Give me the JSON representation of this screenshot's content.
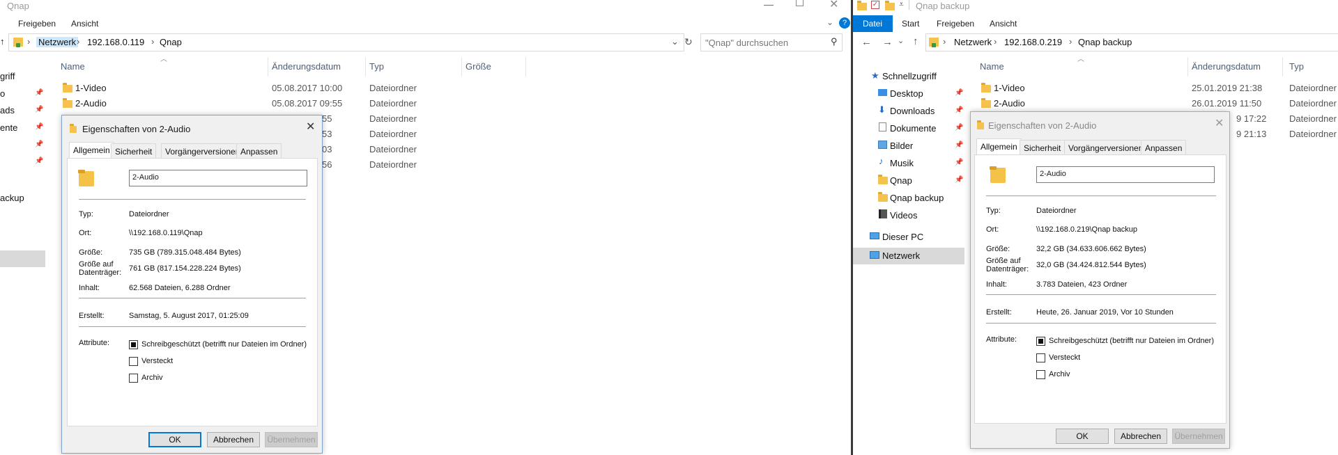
{
  "left_window": {
    "title": "Qnap",
    "ribbon_tabs": [
      "Freigeben",
      "Ansicht"
    ],
    "breadcrumb": [
      "Netzwerk",
      "192.168.0.119",
      "Qnap"
    ],
    "search_placeholder": "\"Qnap\" durchsuchen",
    "columns": {
      "name": "Name",
      "date": "Änderungsdatum",
      "type": "Typ",
      "size": "Größe"
    },
    "rows": [
      {
        "name": "1-Video",
        "date": "05.08.2017 10:00",
        "type": "Dateiordner"
      },
      {
        "name": "2-Audio",
        "date": "05.08.2017 09:55",
        "type": "Dateiordner"
      },
      {
        "name": "",
        "date": "55",
        "type": "Dateiordner"
      },
      {
        "name": "",
        "date": "53",
        "type": "Dateiordner"
      },
      {
        "name": "",
        "date": "03",
        "type": "Dateiordner"
      },
      {
        "name": "",
        "date": "56",
        "type": "Dateiordner"
      }
    ],
    "nav_items": [
      "griff",
      "o",
      "ads",
      "ente",
      "",
      "",
      "ackup"
    ],
    "dialog": {
      "title": "Eigenschaften von 2-Audio",
      "tabs": [
        "Allgemein",
        "Sicherheit",
        "Vorgängerversionen",
        "Anpassen"
      ],
      "name_value": "2-Audio",
      "type_label": "Typ:",
      "type_value": "Dateiordner",
      "location_label": "Ort:",
      "location_value": "\\\\192.168.0.119\\Qnap",
      "size_label": "Größe:",
      "size_value": "735 GB (789.315.048.484 Bytes)",
      "disk_label_1": "Größe auf",
      "disk_label_2": "Datenträger:",
      "disk_value": "761 GB (817.154.228.224 Bytes)",
      "contents_label": "Inhalt:",
      "contents_value": "62.568 Dateien, 6.288 Ordner",
      "created_label": "Erstellt:",
      "created_value": "Samstag, 5. August 2017, 01:25:09",
      "attributes_label": "Attribute:",
      "attr_readonly": "Schreibgeschützt (betrifft nur Dateien im Ordner)",
      "attr_hidden": "Versteckt",
      "attr_archive": "Archiv",
      "ok": "OK",
      "cancel": "Abbrechen",
      "apply": "Übernehmen"
    }
  },
  "right_window": {
    "title": "Qnap backup",
    "ribbon_tabs": [
      "Datei",
      "Start",
      "Freigeben",
      "Ansicht"
    ],
    "breadcrumb": [
      "Netzwerk",
      "192.168.0.219",
      "Qnap backup"
    ],
    "columns": {
      "name": "Name",
      "date": "Änderungsdatum",
      "type": "Typ"
    },
    "rows": [
      {
        "name": "1-Video",
        "date": "25.01.2019 21:38",
        "type": "Dateiordner"
      },
      {
        "name": "2-Audio",
        "date": "26.01.2019 11:50",
        "type": "Dateiordner"
      },
      {
        "name": "",
        "date": "9 17:22",
        "type": "Dateiordner"
      },
      {
        "name": "",
        "date": "9 21:13",
        "type": "Dateiordner"
      }
    ],
    "nav": {
      "quick_access": "Schnellzugriff",
      "items": [
        "Desktop",
        "Downloads",
        "Dokumente",
        "Bilder",
        "Musik",
        "Qnap",
        "Qnap backup",
        "Videos"
      ],
      "this_pc": "Dieser PC",
      "network": "Netzwerk"
    },
    "dialog": {
      "title": "Eigenschaften von 2-Audio",
      "tabs": [
        "Allgemein",
        "Sicherheit",
        "Vorgängerversionen",
        "Anpassen"
      ],
      "name_value": "2-Audio",
      "type_label": "Typ:",
      "type_value": "Dateiordner",
      "location_label": "Ort:",
      "location_value": "\\\\192.168.0.219\\Qnap backup",
      "size_label": "Größe:",
      "size_value": "32,2 GB (34.633.606.662 Bytes)",
      "disk_label_1": "Größe auf",
      "disk_label_2": "Datenträger:",
      "disk_value": "32,0 GB (34.424.812.544 Bytes)",
      "contents_label": "Inhalt:",
      "contents_value": "3.783 Dateien, 423 Ordner",
      "created_label": "Erstellt:",
      "created_value": "Heute, 26. Januar 2019, Vor 10 Stunden",
      "attributes_label": "Attribute:",
      "attr_readonly": "Schreibgeschützt (betrifft nur Dateien im Ordner)",
      "attr_hidden": "Versteckt",
      "attr_archive": "Archiv",
      "ok": "OK",
      "cancel": "Abbrechen",
      "apply": "Übernehmen"
    }
  },
  "colors": {
    "accent": "#0078d7",
    "folder": "#f4c24d",
    "nav_selected": "#cce8ff",
    "divider": "#3a3a3a"
  }
}
